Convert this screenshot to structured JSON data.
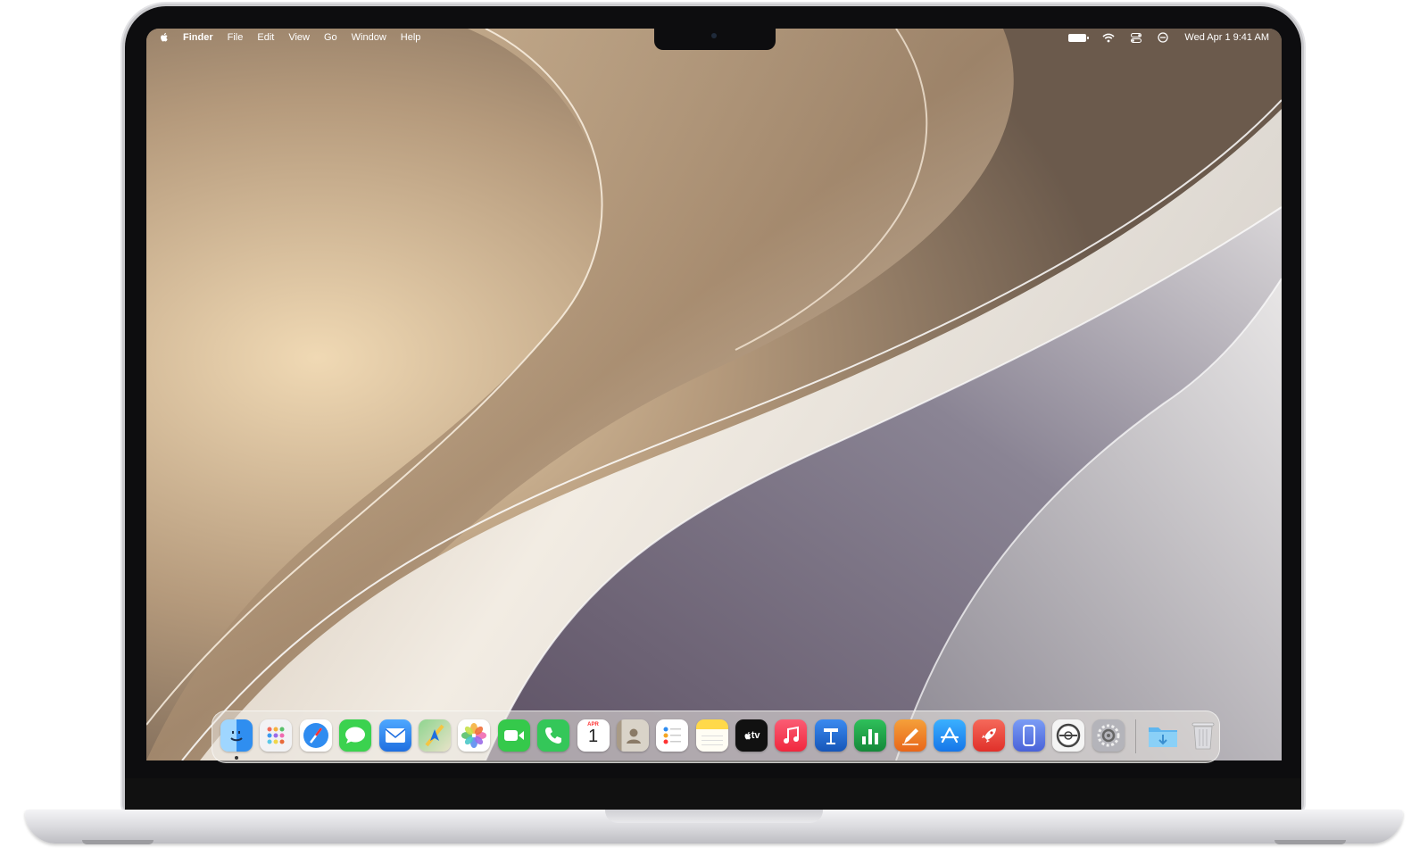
{
  "menubar": {
    "left": [
      "Finder",
      "File",
      "Edit",
      "View",
      "Go",
      "Window",
      "Help"
    ],
    "datetime": "Wed Apr 1  9:41 AM"
  },
  "dock": {
    "calendar_month": "APR",
    "calendar_day": "1",
    "tv_label": "tv",
    "apps": [
      {
        "name": "finder-icon",
        "color": "#3aa0f0"
      },
      {
        "name": "launchpad-icon",
        "color": "#f2f2f4"
      },
      {
        "name": "safari-icon",
        "color": "#2f8cf0"
      },
      {
        "name": "messages-icon",
        "color": "#3bd24f"
      },
      {
        "name": "mail-icon",
        "color": "#2f7fe8"
      },
      {
        "name": "maps-icon",
        "color": "#63b86a"
      },
      {
        "name": "photos-icon",
        "color": "#ffffff"
      },
      {
        "name": "facetime-icon",
        "color": "#35c94b"
      },
      {
        "name": "phone-icon",
        "color": "#34c759"
      },
      {
        "name": "calendar-icon",
        "color": "#ffffff"
      },
      {
        "name": "contacts-icon",
        "color": "#b8a892"
      },
      {
        "name": "reminders-icon",
        "color": "#ffffff"
      },
      {
        "name": "notes-icon",
        "color": "#ffd94a"
      },
      {
        "name": "tv-icon",
        "color": "#111111"
      },
      {
        "name": "music-icon",
        "color": "#fb3c5a"
      },
      {
        "name": "keynote-icon",
        "color": "#1f6fd6"
      },
      {
        "name": "numbers-icon",
        "color": "#1fa346"
      },
      {
        "name": "pages-icon",
        "color": "#f28a1e"
      },
      {
        "name": "app-store-icon",
        "color": "#1e8cf5"
      },
      {
        "name": "rocket-icon",
        "color": "#f04a3c"
      },
      {
        "name": "iphone-mirroring-icon",
        "color": "#5b7ee8"
      },
      {
        "name": "disk-utility-icon",
        "color": "#f4f4f4"
      },
      {
        "name": "system-settings-icon",
        "color": "#9a9aa0"
      },
      {
        "name": "downloads-folder-icon",
        "color": "#5fb6ef"
      },
      {
        "name": "trash-icon",
        "color": "#d8d8dc"
      }
    ]
  }
}
